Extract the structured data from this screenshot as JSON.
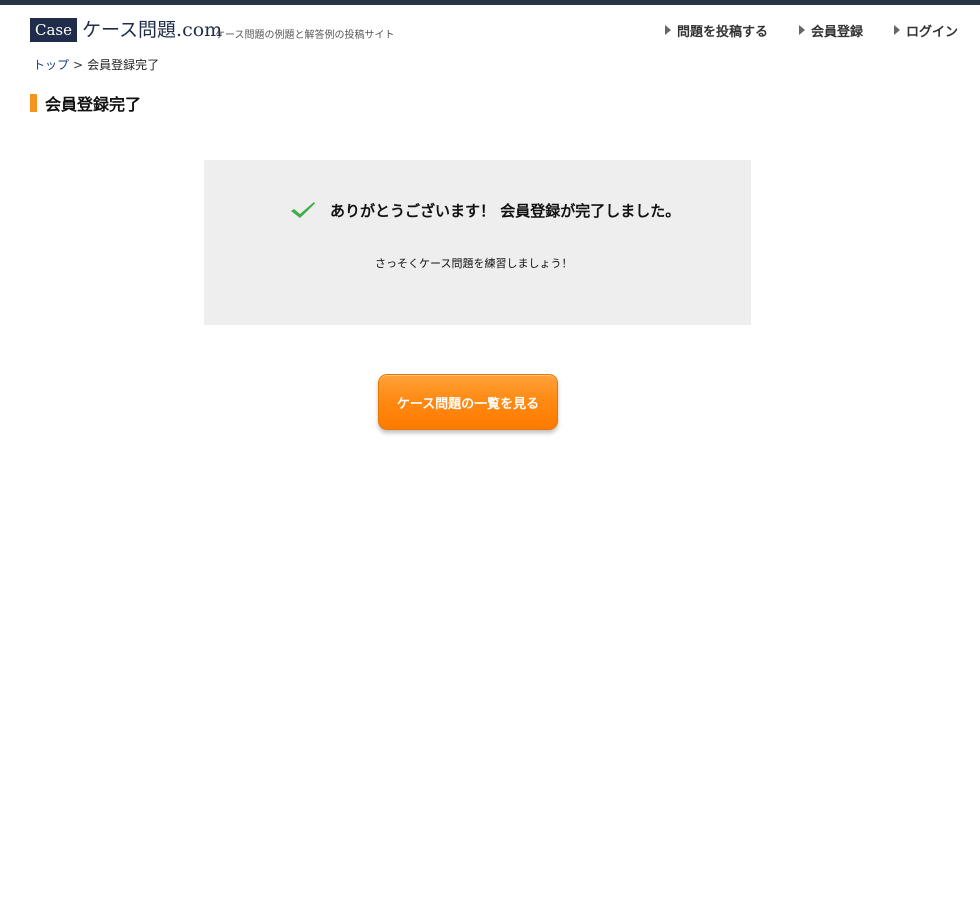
{
  "header": {
    "logo_box": "Case",
    "logo_text": "ケース問題.com",
    "tagline": "ケース問題の例題と解答例の投稿サイト",
    "nav": [
      {
        "label": "問題を投稿する",
        "icon": "triangle-right-icon"
      },
      {
        "label": "会員登録",
        "icon": "triangle-right-icon"
      },
      {
        "label": "ログイン",
        "icon": "triangle-right-icon"
      }
    ]
  },
  "breadcrumb": {
    "home": "トップ",
    "separator": ">",
    "current": "会員登録完了"
  },
  "page": {
    "title": "会員登録完了"
  },
  "message": {
    "icon": "check-icon",
    "title": "ありがとうございます！ 会員登録が完了しました。",
    "subtitle": "さっそくケース問題を練習しましょう！"
  },
  "cta": {
    "label": "ケース問題の一覧を見る"
  },
  "colors": {
    "header_bar": "#2a3447",
    "logo_bg": "#1f2d4a",
    "accent": "#f7941d",
    "button": "#ff8a14",
    "check": "#3fae49",
    "message_bg": "#eeeeee"
  }
}
